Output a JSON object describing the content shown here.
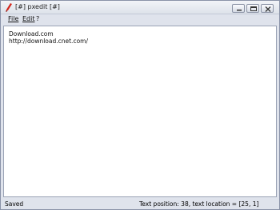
{
  "window": {
    "title": "[#] pxedit [#]"
  },
  "menu": {
    "items": [
      "File",
      "Edit",
      "?"
    ]
  },
  "editor": {
    "lines": [
      "Download.com",
      "http://download.cnet.com/"
    ]
  },
  "status": {
    "left": "Saved",
    "right": "Text position: 38, text location = [25, 1]"
  },
  "colors": {
    "window_bg": "#dfe3ec",
    "editor_bg": "#ffffff",
    "icon_red": "#d2261c"
  }
}
